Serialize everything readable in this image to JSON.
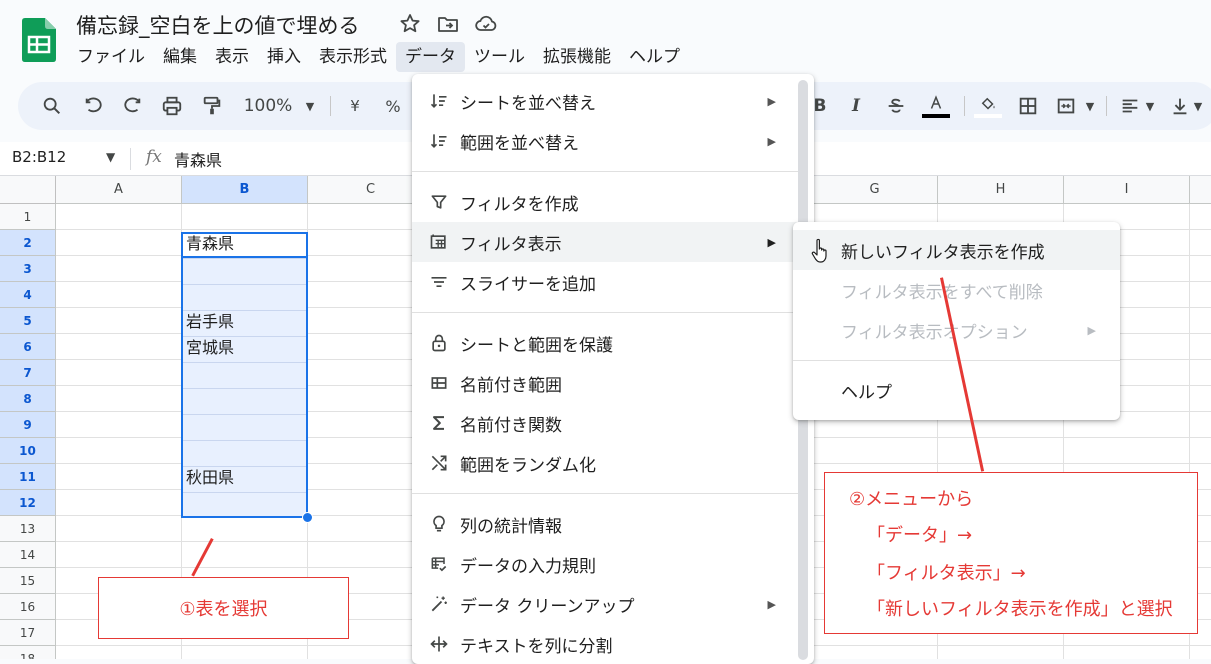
{
  "doc": {
    "title": "備忘録_空白を上の値で埋める"
  },
  "menubar": [
    "ファイル",
    "編集",
    "表示",
    "挿入",
    "表示形式",
    "データ",
    "ツール",
    "拡張機能",
    "ヘルプ"
  ],
  "toolbar": {
    "zoom": "100%",
    "currency": "¥",
    "percent": "%"
  },
  "formula_bar": {
    "name_box": "B2:B12",
    "fx": "fx",
    "value": "青森県"
  },
  "columns": [
    "A",
    "B",
    "C",
    "G",
    "H",
    "I"
  ],
  "rows": [
    "1",
    "2",
    "3",
    "4",
    "5",
    "6",
    "7",
    "8",
    "9",
    "10",
    "11",
    "12",
    "13",
    "14",
    "15",
    "16",
    "17",
    "18"
  ],
  "cells": {
    "B2": "青森県",
    "B5": "岩手県",
    "B6": "宮城県",
    "B11": "秋田県"
  },
  "data_menu": {
    "items": [
      "シートを並べ替え",
      "範囲を並べ替え",
      "フィルタを作成",
      "フィルタ表示",
      "スライサーを追加",
      "シートと範囲を保護",
      "名前付き範囲",
      "名前付き関数",
      "範囲をランダム化",
      "列の統計情報",
      "データの入力規則",
      "データ クリーンアップ",
      "テキストを列に分割"
    ]
  },
  "filter_submenu": {
    "items": [
      "新しいフィルタ表示を作成",
      "フィルタ表示をすべて削除",
      "フィルタ表示オプション",
      "ヘルプ"
    ]
  },
  "annotations": {
    "note1": "①表を選択",
    "note2": [
      "②メニューから",
      "「データ」→",
      "「フィルタ表示」→",
      "「新しいフィルタ表示を作成」と選択"
    ]
  },
  "colors": {
    "selection": "#1a73e8",
    "annotation": "#e53935",
    "sheets_green": "#0f9d58"
  }
}
